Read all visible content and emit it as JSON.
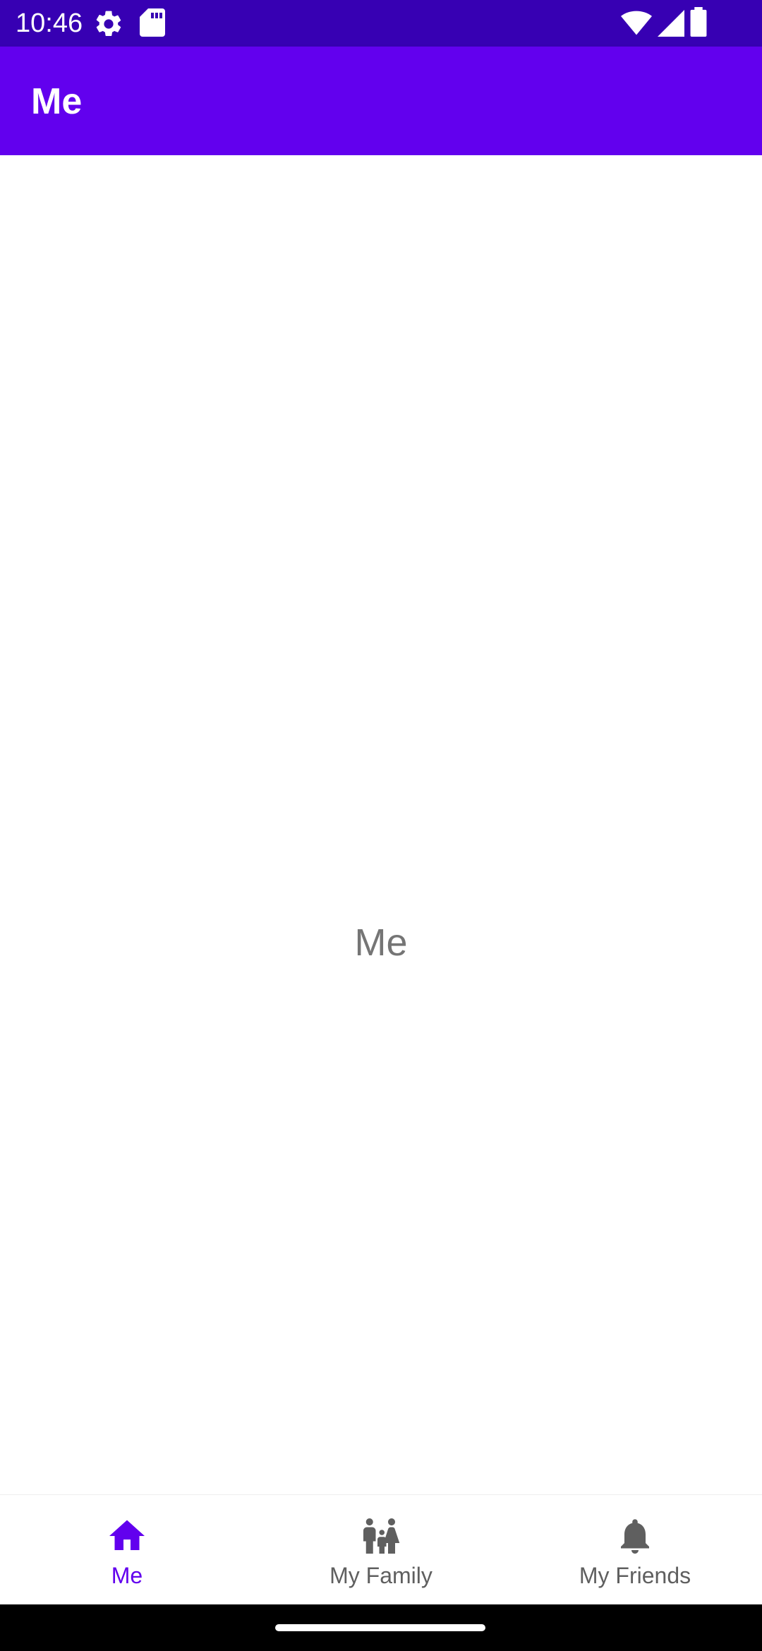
{
  "status_bar": {
    "time": "10:46",
    "icons": [
      "settings-gear-icon",
      "sd-card-icon",
      "wifi-icon",
      "cellular-signal-icon",
      "battery-icon"
    ],
    "background": "#3700B3"
  },
  "app_bar": {
    "title": "Me",
    "background": "#6200EE"
  },
  "content": {
    "text": "Me"
  },
  "bottom_nav": {
    "items": [
      {
        "label": "Me",
        "icon": "home-icon",
        "active": true
      },
      {
        "label": "My Family",
        "icon": "family-icon",
        "active": false
      },
      {
        "label": "My Friends",
        "icon": "bell-icon",
        "active": false
      }
    ],
    "active_color": "#6200EE",
    "inactive_color": "#5f5f5f"
  }
}
